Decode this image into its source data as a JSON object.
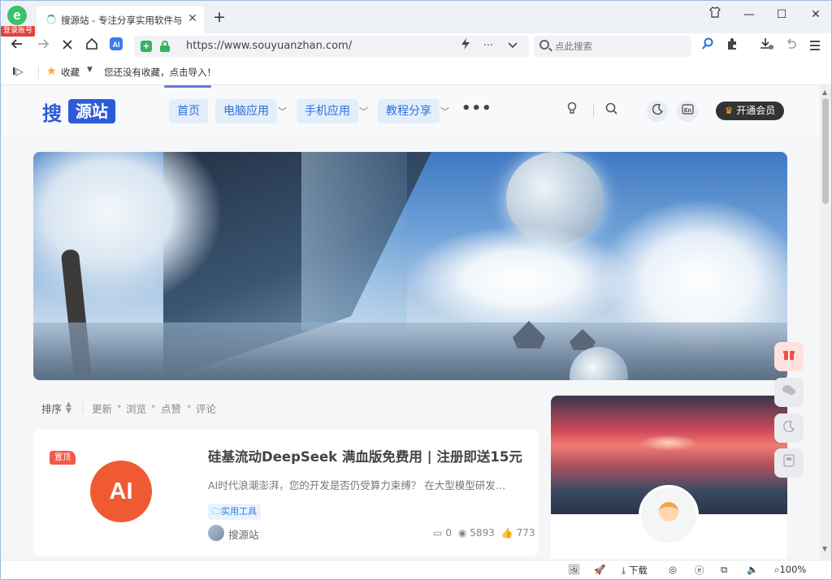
{
  "browser": {
    "login_badge": "登录账号",
    "tab": {
      "title": "搜源站 - 专注分享实用软件与"
    },
    "address": {
      "url": "https://www.souyuanzhan.com/"
    },
    "search": {
      "placeholder": "点此搜索"
    },
    "bookmarks": {
      "favorites_label": "收藏",
      "empty_hint": "您还没有收藏，点击导入！"
    },
    "status": {
      "download_label": "下载",
      "zoom": "100%"
    }
  },
  "site": {
    "logo": {
      "sou": "搜",
      "box_text": "源站"
    },
    "nav": [
      {
        "label": "首页",
        "has_dropdown": false
      },
      {
        "label": "电脑应用",
        "has_dropdown": true
      },
      {
        "label": "手机应用",
        "has_dropdown": true
      },
      {
        "label": "教程分享",
        "has_dropdown": true
      }
    ],
    "more_label": "•••",
    "vip_label": "开通会员",
    "colors": {
      "brand": "#2d5bd8",
      "nav_bg": "#e3eefb",
      "badge": "#f05a4a",
      "ai_thumb": "#f05a32"
    }
  },
  "sort": {
    "label": "排序",
    "options": [
      "更新",
      "浏览",
      "点赞",
      "评论"
    ]
  },
  "post": {
    "pin_badge": "置顶",
    "thumb_text": "AI",
    "title": "硅基流动DeepSeek 满血版免费用 | 注册即送15元",
    "excerpt": "AI时代浪潮澎湃，您的开发是否仍受算力束缚？ 在大型模型研发…",
    "tag": "实用工具",
    "author": "搜源站",
    "comments": "0",
    "views": "5893",
    "likes": "773"
  },
  "icons": {
    "back": "arrow-left-icon",
    "forward": "arrow-right-icon",
    "stop": "close-icon",
    "home": "home-icon",
    "ai": "ai-assistant-icon",
    "bolt": "lightning-icon",
    "search": "search-icon",
    "puzzle": "extension-icon",
    "download": "download-icon",
    "undo": "undo-icon",
    "menu": "menu-icon",
    "theme": "moon-icon",
    "lang": "language-icon",
    "gift": "gift-icon",
    "wechat": "wechat-icon",
    "qr": "qrcode-icon"
  }
}
